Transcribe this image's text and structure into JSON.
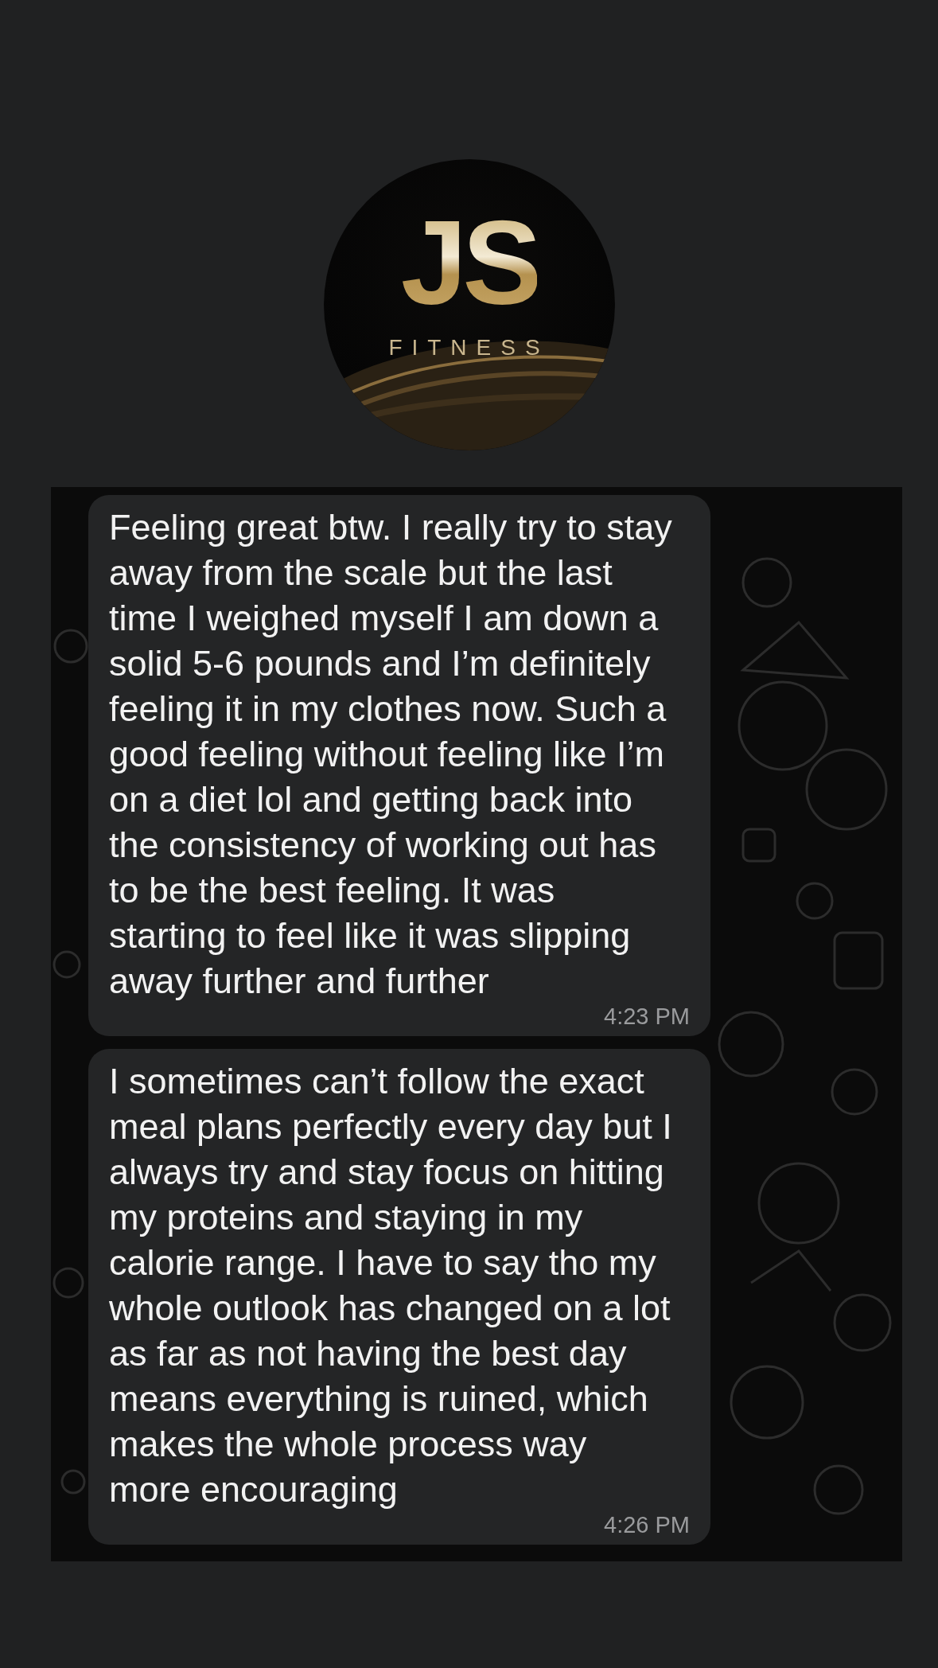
{
  "logo": {
    "monogram": "JS",
    "tagline": "FITNESS"
  },
  "messages": [
    {
      "text": "Feeling great btw. I really try to stay\naway from the scale but the last\ntime I weighed myself I am down a\nsolid 5-6 pounds and I’m definitely\nfeeling it in my clothes now. Such a\ngood feeling without feeling like I’m\non a diet lol and getting back into\nthe consistency of working out has\nto be the best feeling. It was\nstarting to feel like it was slipping\naway further and further",
      "time": "4:23 PM"
    },
    {
      "text": "I sometimes can’t follow the exact\nmeal plans perfectly every day but I\nalways try and stay focus on hitting\nmy proteins and staying in my\ncalorie range. I have to say tho my\nwhole outlook has changed on a lot\nas far as not having the best day\nmeans everything is ruined, which\nmakes the whole process way\nmore encouraging",
      "time": "4:26 PM"
    }
  ]
}
